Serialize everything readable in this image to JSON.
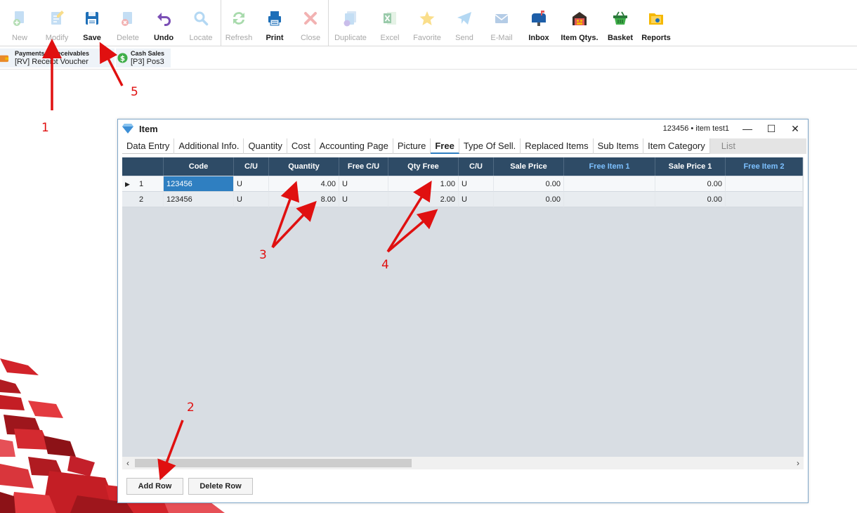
{
  "toolbar": {
    "buttons": [
      {
        "label": "New",
        "icon": "new-icon",
        "enabled": false
      },
      {
        "label": "Modify",
        "icon": "modify-icon",
        "enabled": false
      },
      {
        "label": "Save",
        "icon": "save-icon",
        "enabled": true
      },
      {
        "label": "Delete",
        "icon": "delete-icon",
        "enabled": false
      },
      {
        "label": "Undo",
        "icon": "undo-icon",
        "enabled": true
      },
      {
        "label": "Locate",
        "icon": "locate-icon",
        "enabled": false
      },
      {
        "label": "Refresh",
        "icon": "refresh-icon",
        "enabled": false
      },
      {
        "label": "Print",
        "icon": "print-icon",
        "enabled": true
      },
      {
        "label": "Close",
        "icon": "close-icon",
        "enabled": false
      },
      {
        "label": "Duplicate",
        "icon": "duplicate-icon",
        "enabled": false
      },
      {
        "label": "Excel",
        "icon": "excel-icon",
        "enabled": false
      },
      {
        "label": "Favorite",
        "icon": "favorite-icon",
        "enabled": false
      },
      {
        "label": "Send",
        "icon": "send-icon",
        "enabled": false
      },
      {
        "label": "E-Mail",
        "icon": "email-icon",
        "enabled": false
      },
      {
        "label": "Inbox",
        "icon": "inbox-icon",
        "enabled": true
      },
      {
        "label": "Item Qtys.",
        "icon": "warehouse-icon",
        "enabled": true
      },
      {
        "label": "Basket",
        "icon": "basket-icon",
        "enabled": true
      },
      {
        "label": "Reports",
        "icon": "reports-icon",
        "enabled": true
      }
    ]
  },
  "open_windows": [
    {
      "title": "Payments & Receivables",
      "subtitle": "[RV] Receipt Voucher",
      "icon": "wallet-icon"
    },
    {
      "title": "Cash Sales",
      "subtitle": "[P3] Pos3",
      "icon": "dollar-icon"
    }
  ],
  "item_window": {
    "title": "Item",
    "record": "123456  •  item test1",
    "controls": {
      "minimize": "—",
      "maximize": "☐",
      "close": "✕"
    },
    "tabs": [
      {
        "label": "Data Entry"
      },
      {
        "label": "Additional Info."
      },
      {
        "label": "Quantity"
      },
      {
        "label": "Cost"
      },
      {
        "label": "Accounting Page"
      },
      {
        "label": "Picture"
      },
      {
        "label": "Free",
        "active": true
      },
      {
        "label": "Type Of Sell."
      },
      {
        "label": "Replaced Items"
      },
      {
        "label": "Sub Items"
      },
      {
        "label": "Item Category"
      },
      {
        "label": "List",
        "grey": true
      }
    ],
    "grid": {
      "columns": [
        "",
        "Code",
        "C/U",
        "Quantity",
        "Free C/U",
        "Qty Free",
        "C/U",
        "Sale Price",
        "Free Item 1",
        "Sale Price 1",
        "Free Item 2"
      ],
      "accent_columns": [
        "Free Item 1",
        "Free Item 2"
      ],
      "rows": [
        {
          "no": "1",
          "code": "123456",
          "cu": "U",
          "quantity": "4.00",
          "free_cu": "U",
          "qty_free": "1.00",
          "cu2": "U",
          "sale_price": "0.00",
          "free_item_1": "",
          "sale_price_1": "0.00",
          "free_item_2": ""
        },
        {
          "no": "2",
          "code": "123456",
          "cu": "U",
          "quantity": "8.00",
          "free_cu": "U",
          "qty_free": "2.00",
          "cu2": "U",
          "sale_price": "0.00",
          "free_item_1": "",
          "sale_price_1": "0.00",
          "free_item_2": ""
        }
      ]
    },
    "buttons": {
      "add_row": "Add Row",
      "delete_row": "Delete Row"
    }
  },
  "annotations": {
    "labels": [
      "1",
      "2",
      "3",
      "4",
      "5"
    ],
    "color": "#e01010"
  },
  "colors": {
    "grid_header": "#2e4b66",
    "accent_header_text": "#7cc0ff",
    "selection": "#2f7fc1",
    "grid_background": "#d8dde3"
  }
}
